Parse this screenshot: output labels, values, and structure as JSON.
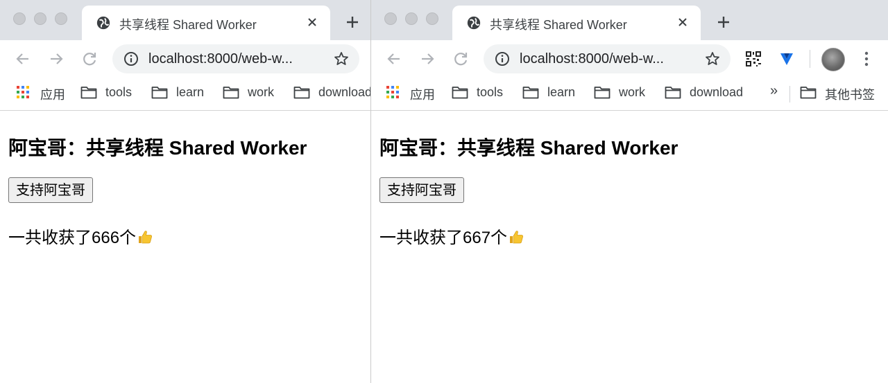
{
  "windows": [
    {
      "tab": {
        "title": "共享线程 Shared Worker"
      },
      "address": {
        "url": "localhost:8000/web-w..."
      },
      "bookmarks": [
        {
          "label": "应用",
          "icon": "apps-grid-icon"
        },
        {
          "label": "tools",
          "icon": "folder-icon"
        },
        {
          "label": "learn",
          "icon": "folder-icon"
        },
        {
          "label": "work",
          "icon": "folder-icon"
        },
        {
          "label": "download",
          "icon": "folder-icon"
        }
      ],
      "page": {
        "heading": "阿宝哥：共享线程 Shared Worker",
        "button_label": "支持阿宝哥",
        "count_text": "一共收获了666个"
      }
    },
    {
      "tab": {
        "title": "共享线程 Shared Worker"
      },
      "address": {
        "url": "localhost:8000/web-w..."
      },
      "bookmarks": [
        {
          "label": "应用",
          "icon": "apps-grid-icon"
        },
        {
          "label": "tools",
          "icon": "folder-icon"
        },
        {
          "label": "learn",
          "icon": "folder-icon"
        },
        {
          "label": "work",
          "icon": "folder-icon"
        },
        {
          "label": "download",
          "icon": "folder-icon"
        }
      ],
      "overflow_chevron": "»",
      "other_bookmarks": {
        "label": "其他书签",
        "icon": "folder-icon"
      },
      "extensions": [
        "qr-code-icon",
        "blue-extension-icon"
      ],
      "page": {
        "heading": "阿宝哥：共享线程 Shared Worker",
        "button_label": "支持阿宝哥",
        "count_text": "一共收获了667个"
      }
    }
  ],
  "colors": {
    "tab_strip": "#dee1e6",
    "omnibox": "#f1f3f4",
    "icon_gray": "#5f6368",
    "button_bg": "#efefef"
  }
}
